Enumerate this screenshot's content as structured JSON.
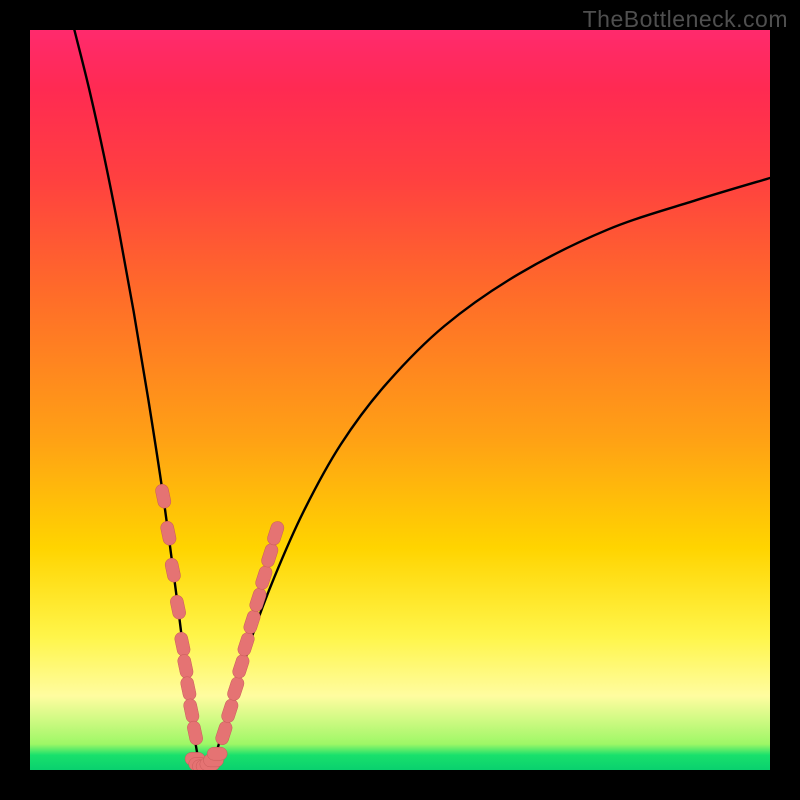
{
  "watermark": "TheBottleneck.com",
  "colors": {
    "frame": "#000000",
    "curve": "#000000",
    "marker_fill": "#e57373",
    "marker_stroke": "#c95b5b"
  },
  "chart_data": {
    "type": "line",
    "title": "",
    "xlabel": "",
    "ylabel": "",
    "xlim": [
      0,
      100
    ],
    "ylim": [
      0,
      100
    ],
    "note": "Axes unlabeled in source image; x/y are normalized 0–100. Curve is a V-shaped dip (bottleneck) bottoming out near x≈23, y≈0; left branch steeper than right which asymptotes near y≈80.",
    "series": [
      {
        "name": "bottleneck-curve",
        "x": [
          6,
          8,
          10,
          12,
          14,
          16,
          18,
          20,
          21,
          22,
          23,
          24,
          25,
          26,
          28,
          30,
          33,
          37,
          42,
          48,
          56,
          66,
          78,
          90,
          100
        ],
        "y": [
          100,
          92,
          83,
          73,
          62,
          50,
          37,
          22,
          14,
          6,
          0.5,
          0.5,
          2,
          5,
          11,
          18,
          26,
          35,
          44,
          52,
          60,
          67,
          73,
          77,
          80
        ]
      }
    ],
    "markers": {
      "left_branch": [
        {
          "x": 18,
          "y": 37
        },
        {
          "x": 18.7,
          "y": 32
        },
        {
          "x": 19.3,
          "y": 27
        },
        {
          "x": 20,
          "y": 22
        },
        {
          "x": 20.6,
          "y": 17
        },
        {
          "x": 21,
          "y": 14
        },
        {
          "x": 21.4,
          "y": 11
        },
        {
          "x": 21.8,
          "y": 8
        },
        {
          "x": 22.3,
          "y": 5
        }
      ],
      "bottom": [
        {
          "x": 22.3,
          "y": 1.5
        },
        {
          "x": 22.8,
          "y": 0.8
        },
        {
          "x": 23.3,
          "y": 0.5
        },
        {
          "x": 23.8,
          "y": 0.5
        },
        {
          "x": 24.3,
          "y": 0.8
        },
        {
          "x": 24.8,
          "y": 1.3
        },
        {
          "x": 25.3,
          "y": 2.2
        }
      ],
      "right_branch": [
        {
          "x": 26.2,
          "y": 5
        },
        {
          "x": 27,
          "y": 8
        },
        {
          "x": 27.8,
          "y": 11
        },
        {
          "x": 28.5,
          "y": 14
        },
        {
          "x": 29.2,
          "y": 17
        },
        {
          "x": 30,
          "y": 20
        },
        {
          "x": 30.8,
          "y": 23
        },
        {
          "x": 31.6,
          "y": 26
        },
        {
          "x": 32.4,
          "y": 29
        },
        {
          "x": 33.2,
          "y": 32
        }
      ]
    }
  }
}
